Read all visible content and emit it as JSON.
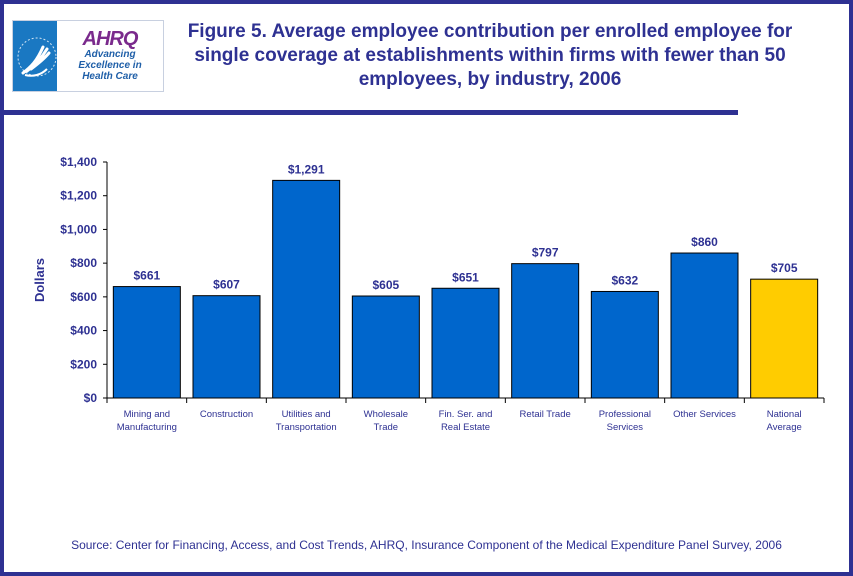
{
  "logo": {
    "hhs_icon": "hhs-eagle-seal-icon",
    "brand": "AHRQ",
    "tagline": [
      "Advancing",
      "Excellence in",
      "Health Care"
    ]
  },
  "title": "Figure 5. Average employee contribution per enrolled employee for single coverage at establishments within firms with fewer than 50 employees, by industry, 2006",
  "source": "Source: Center for Financing, Access, and Cost Trends, AHRQ, Insurance Component of the Medical Expenditure Panel Survey, 2006",
  "colors": {
    "frame": "#2e3192",
    "bar": "#0066cc",
    "highlight_bar": "#ffcc00",
    "text": "#2e3192"
  },
  "chart_data": {
    "type": "bar",
    "title": "Figure 5. Average employee contribution per enrolled employee for single coverage at establishments within firms with fewer than 50 employees, by industry, 2006",
    "xlabel": "",
    "ylabel": "Dollars",
    "ylim": [
      0,
      1400
    ],
    "yticks": [
      0,
      200,
      400,
      600,
      800,
      1000,
      1200,
      1400
    ],
    "ytick_labels": [
      "$0",
      "$200",
      "$400",
      "$600",
      "$800",
      "$1,000",
      "$1,200",
      "$1,400"
    ],
    "grid": false,
    "legend": "none",
    "categories": [
      [
        "Mining and",
        "Manufacturing"
      ],
      [
        "Construction"
      ],
      [
        "Utilities and",
        "Transportation"
      ],
      [
        "Wholesale",
        "Trade"
      ],
      [
        "Fin. Ser. and",
        "Real Estate"
      ],
      [
        "Retail Trade"
      ],
      [
        "Professional",
        "Services"
      ],
      [
        "Other Services"
      ],
      [
        "National",
        "Average"
      ]
    ],
    "values": [
      661,
      607,
      1291,
      605,
      651,
      797,
      632,
      860,
      705
    ],
    "data_labels": [
      "$661",
      "$607",
      "$1,291",
      "$605",
      "$651",
      "$797",
      "$632",
      "$860",
      "$705"
    ],
    "highlight_index": 8
  }
}
